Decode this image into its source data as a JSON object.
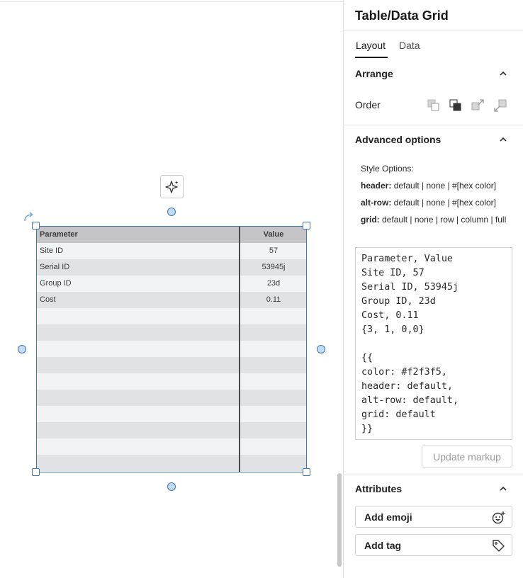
{
  "panel": {
    "title": "Table/Data Grid",
    "tabs": [
      {
        "label": "Layout",
        "active": true
      },
      {
        "label": "Data",
        "active": false
      }
    ],
    "arrange": {
      "title": "Arrange",
      "order_label": "Order"
    },
    "advanced": {
      "title": "Advanced options",
      "style_title": "Style Options:",
      "header_key": "header:",
      "header_values": " default | none | #[hex color]",
      "altrow_key": "alt-row:",
      "altrow_values": " default | none | #[hex color]",
      "grid_key": "grid:",
      "grid_values": " default | none | row | column | full"
    },
    "markup_text": "Parameter, Value\nSite ID, 57\nSerial ID, 53945j\nGroup ID, 23d\nCost, 0.11\n{3, 1, 0,0}\n\n{{\ncolor: #f2f3f5,\nheader: default,\nalt-row: default,\ngrid: default\n}}",
    "update_button": "Update markup",
    "attributes": {
      "title": "Attributes",
      "add_emoji": "Add emoji",
      "add_tag": "Add tag"
    }
  },
  "grid": {
    "header": [
      "Parameter",
      "Value"
    ],
    "rows": [
      [
        "Site ID",
        "57"
      ],
      [
        "Serial ID",
        "53945j"
      ],
      [
        "Group ID",
        "23d"
      ],
      [
        "Cost",
        "0.11"
      ],
      [
        "",
        ""
      ],
      [
        "",
        ""
      ],
      [
        "",
        ""
      ],
      [
        "",
        ""
      ],
      [
        "",
        ""
      ],
      [
        "",
        ""
      ],
      [
        "",
        ""
      ],
      [
        "",
        ""
      ],
      [
        "",
        ""
      ],
      [
        "",
        ""
      ]
    ],
    "colors": {
      "header": "#c5c4c9",
      "row": "#f2f3f5",
      "alt_row": "#e1e2e5"
    }
  },
  "icons": {
    "ai": "sparkle-icon",
    "rotate": "rotate-icon",
    "order": [
      "send-to-back-icon",
      "bring-to-front-icon",
      "bring-forward-icon",
      "send-backward-icon"
    ],
    "emoji": "add-emoji-icon",
    "tag": "tag-icon"
  },
  "colors": {
    "selection": "#3d78b3",
    "handle_fill": "#c3dcf5"
  }
}
